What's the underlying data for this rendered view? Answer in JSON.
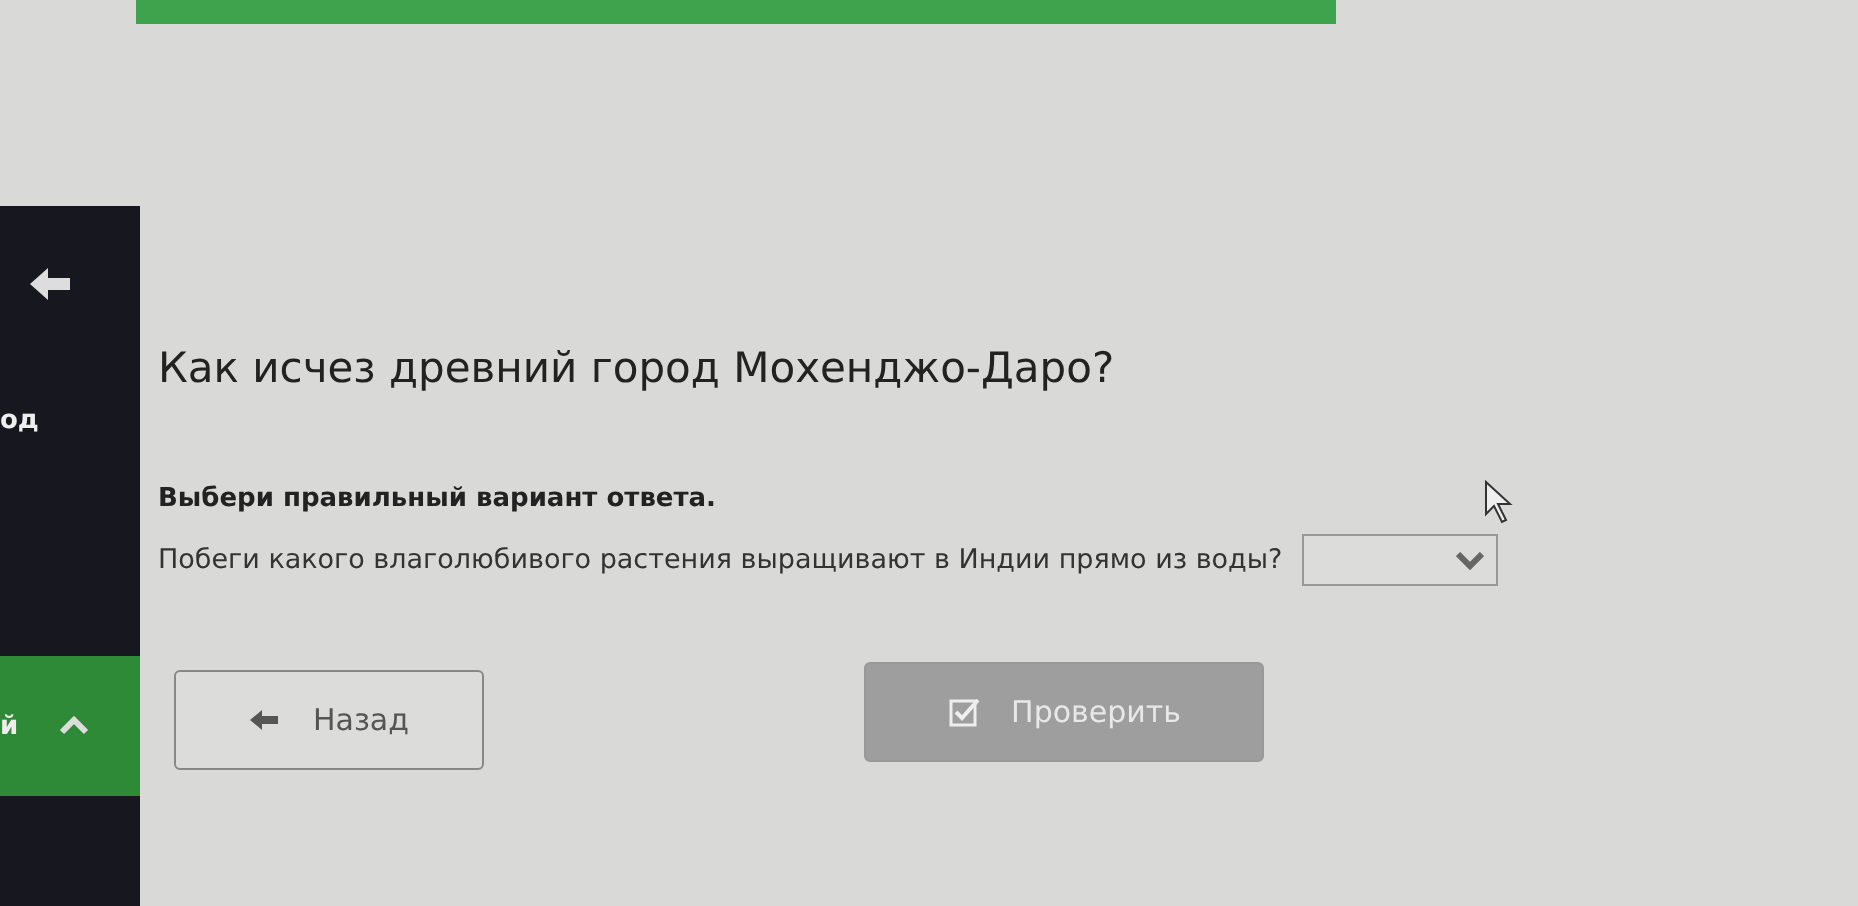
{
  "sidebar": {
    "label": "од",
    "section": {
      "label": "й",
      "expanded": true
    }
  },
  "question": {
    "title": "Как исчез древний город Мохенджо-Даро?",
    "instruction": "Выбери правильный вариант ответа.",
    "prompt": "Побеги какого влаголюбивого растения выращивают в Индии прямо из воды?"
  },
  "buttons": [
    {
      "kind": "back",
      "label": "Назад",
      "disabled": false
    },
    {
      "kind": "check",
      "label": "Проверить",
      "disabled": true
    }
  ]
}
